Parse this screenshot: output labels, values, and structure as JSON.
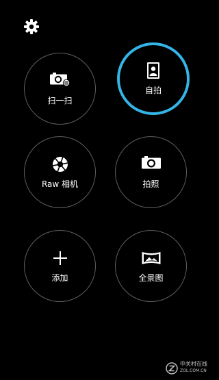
{
  "settings": {
    "icon": "gear-icon"
  },
  "modes": [
    {
      "label": "扫一扫",
      "icon": "scan-camera-icon",
      "selected": false
    },
    {
      "label": "自拍",
      "icon": "selfie-portrait-icon",
      "selected": true
    },
    {
      "label": "Raw 相机",
      "icon": "aperture-icon",
      "selected": false
    },
    {
      "label": "拍照",
      "icon": "camera-icon",
      "selected": false
    },
    {
      "label": "添加",
      "icon": "plus-icon",
      "selected": false
    },
    {
      "label": "全景图",
      "icon": "panorama-icon",
      "selected": false
    }
  ],
  "colors": {
    "background": "#000000",
    "ring": "#5f5f5f",
    "accent": "#33b5e5",
    "text": "#ffffff"
  },
  "watermark": {
    "brand": "中关村在线",
    "domain": "ZOL.COM.CN"
  }
}
